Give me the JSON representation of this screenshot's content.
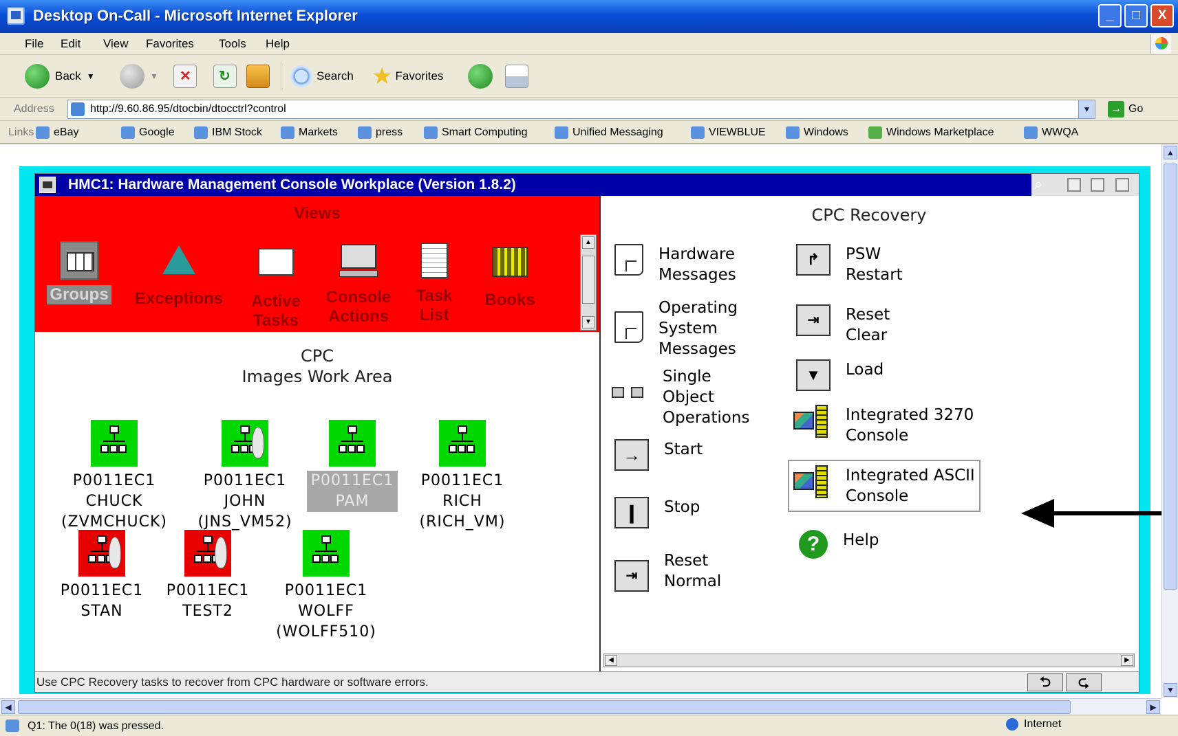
{
  "window": {
    "title": "Desktop On-Call - Microsoft Internet Explorer",
    "controls": {
      "minimize": "_",
      "maximize": "□",
      "close": "X"
    }
  },
  "menu": [
    "File",
    "Edit",
    "View",
    "Favorites",
    "Tools",
    "Help"
  ],
  "toolbar": {
    "back": "Back",
    "search": "Search",
    "favorites": "Favorites"
  },
  "address": {
    "label": "Address",
    "url": "http://9.60.86.95/dtocbin/dtocctrl?control",
    "go": "Go"
  },
  "links": {
    "label": "Links",
    "items": [
      "eBay",
      "Google",
      "IBM Stock",
      "Markets",
      "press",
      "Smart Computing",
      "Unified Messaging",
      "VIEWBLUE",
      "Windows",
      "Windows Marketplace",
      "WWQA"
    ]
  },
  "hmc": {
    "title": "HMC1: Hardware Management Console Workplace (Version 1.8.2)",
    "views": {
      "title": "Views",
      "items": [
        {
          "label": "Groups",
          "icon": "groups-icon"
        },
        {
          "label": "Exceptions",
          "icon": "exceptions-icon"
        },
        {
          "label": "Active Tasks",
          "icon": "folder-icon"
        },
        {
          "label": "Console Actions",
          "icon": "console-icon"
        },
        {
          "label": "Task List",
          "icon": "tasklist-icon"
        },
        {
          "label": "Books",
          "icon": "books-icon"
        }
      ]
    },
    "work_area": {
      "title_line1": "CPC",
      "title_line2": "Images Work Area",
      "images": [
        {
          "line1": "P0011EC1",
          "line2": "CHUCK",
          "line3": "(ZVMCHUCK)",
          "status": "green",
          "selected": false
        },
        {
          "line1": "P0011EC1",
          "line2": "JOHN",
          "line3": "(JNS_VM52)",
          "status": "green",
          "selected": false
        },
        {
          "line1": "P0011EC1",
          "line2": "PAM",
          "line3": "",
          "status": "green",
          "selected": true
        },
        {
          "line1": "P0011EC1",
          "line2": "RICH",
          "line3": "(RICH_VM)",
          "status": "green",
          "selected": false
        },
        {
          "line1": "P0011EC1",
          "line2": "STAN",
          "line3": "",
          "status": "red",
          "selected": false
        },
        {
          "line1": "P0011EC1",
          "line2": "TEST2",
          "line3": "",
          "status": "red",
          "selected": false
        },
        {
          "line1": "P0011EC1",
          "line2": "WOLFF",
          "line3": "(WOLFF510)",
          "status": "green",
          "selected": false
        }
      ]
    },
    "recovery": {
      "title": "CPC Recovery",
      "left_tasks": [
        {
          "label": "Hardware\nMessages"
        },
        {
          "label": "Operating\nSystem\nMessages"
        },
        {
          "label": "Single\nObject\nOperations"
        },
        {
          "label": "Start"
        },
        {
          "label": "Stop"
        },
        {
          "label": "Reset\nNormal"
        }
      ],
      "right_tasks": [
        {
          "label": "PSW\nRestart"
        },
        {
          "label": "Reset\nClear"
        },
        {
          "label": "Load"
        },
        {
          "label": "Integrated 3270\nConsole"
        },
        {
          "label": "Integrated ASCII\nConsole"
        },
        {
          "label": "Help"
        }
      ]
    },
    "status_message": "Use CPC Recovery tasks to recover from CPC hardware or software errors."
  },
  "statusbar": {
    "message": "Q1: The 0(18) was pressed.",
    "zone": "Internet"
  },
  "colors": {
    "views_bg": "#ff0000",
    "cyan_frame": "#00e5f0",
    "hmc_titlebar": "#0000a8",
    "cpc_ok": "#00d800",
    "cpc_error": "#e80000"
  }
}
